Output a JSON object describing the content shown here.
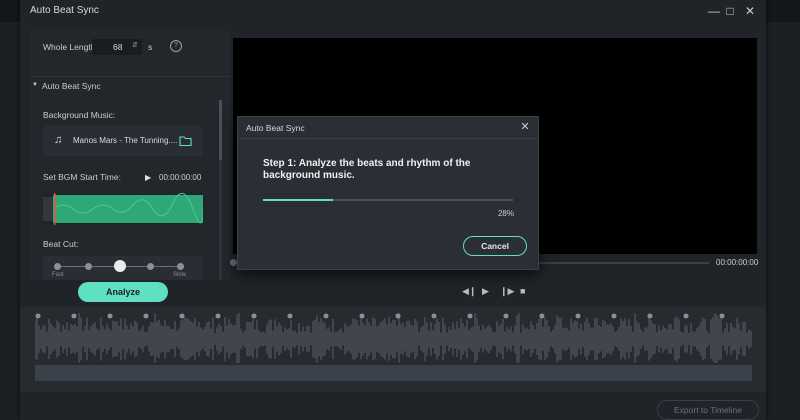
{
  "window": {
    "title": "Auto Beat Sync",
    "min_icon": "minimize-icon",
    "max_icon": "maximize-icon",
    "close_icon": "close-icon"
  },
  "left_panel": {
    "whole_length_label": "Whole Length:",
    "whole_length_value": "68",
    "whole_length_unit": "s",
    "section_title": "Auto Beat Sync",
    "bg_music_label": "Background Music:",
    "music_name": "Manos Mars - The Tunning....",
    "bgm_start_label": "Set BGM Start Time:",
    "bgm_start_time": "00:00:00:00",
    "beat_cut_label": "Beat Cut:",
    "beat_cut_min": "Fast",
    "beat_cut_max": "Slow",
    "beat_cut_level": 0.5,
    "analyze_label": "Analyze"
  },
  "preview": {
    "time": "00:00:00:00"
  },
  "timeline": {
    "export_label": "Export to Timeline"
  },
  "dialog": {
    "title": "Auto Beat Sync",
    "message": "Step 1: Analyze the beats and rhythm of the background music.",
    "progress_percent": 28,
    "progress_text": "28%",
    "cancel_label": "Cancel"
  },
  "colors": {
    "accent": "#5fe0c2",
    "wave": "#2fa878",
    "background": "#202429"
  }
}
